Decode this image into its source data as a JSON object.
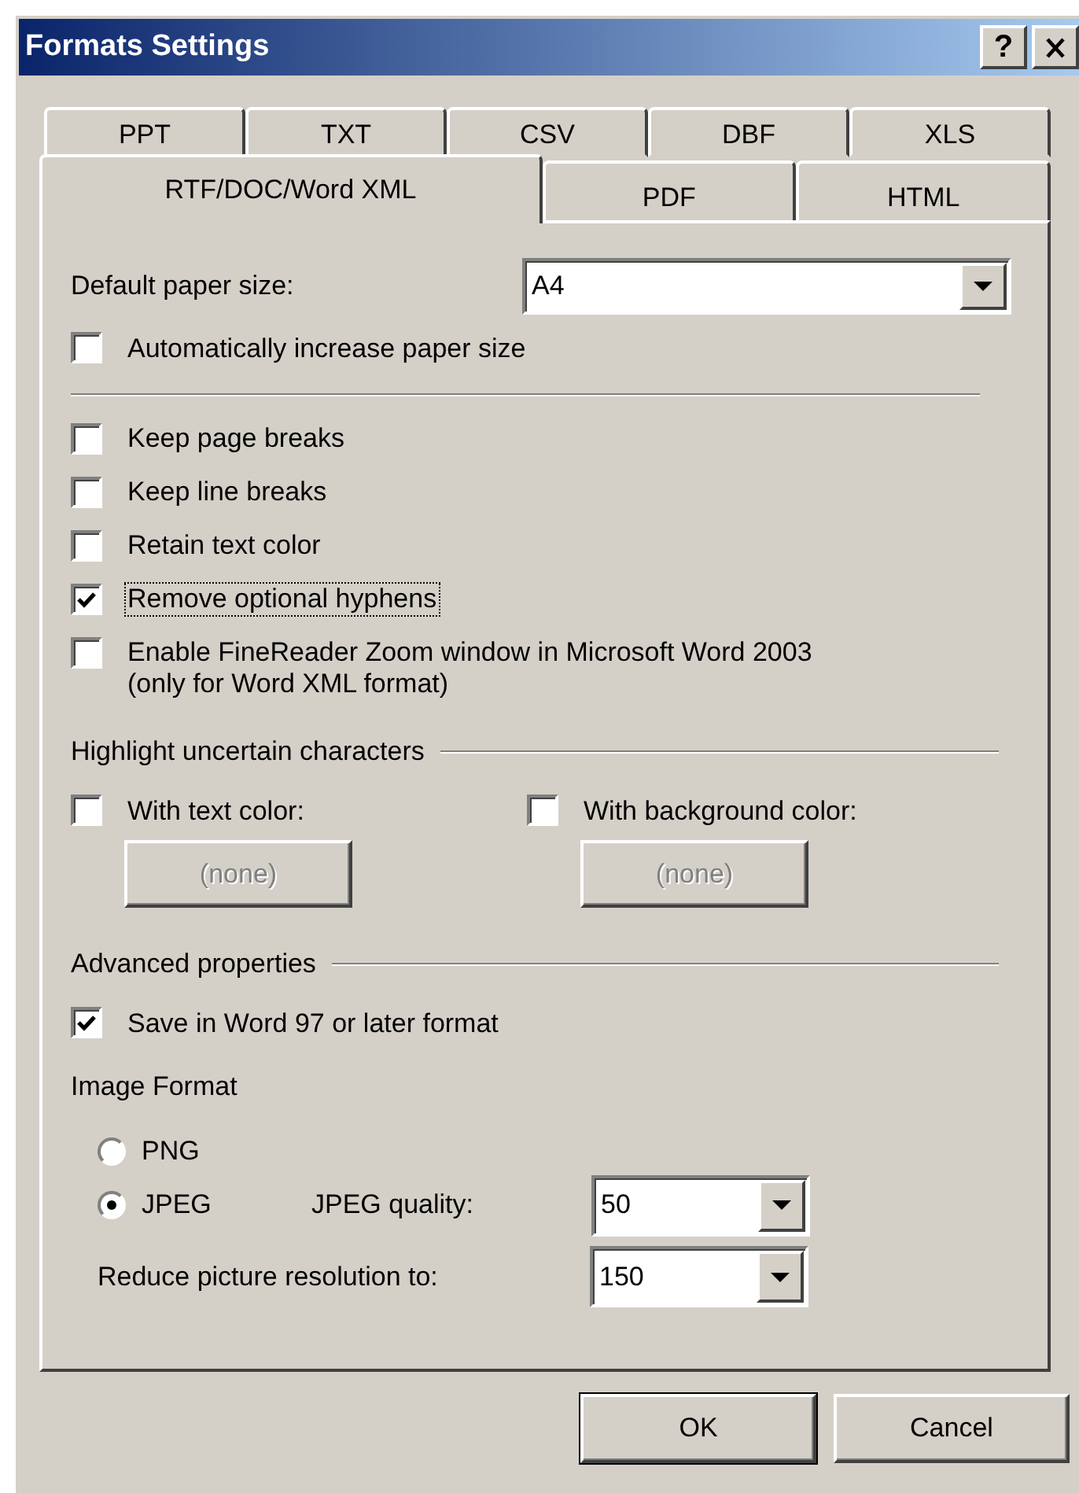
{
  "window": {
    "title": "Formats Settings",
    "help_button": "?"
  },
  "tab_rows": [
    [
      {
        "label": "PPT",
        "selected": false
      },
      {
        "label": "TXT",
        "selected": false
      },
      {
        "label": "CSV",
        "selected": false
      },
      {
        "label": "DBF",
        "selected": false
      },
      {
        "label": "XLS",
        "selected": false
      }
    ],
    [
      {
        "label": "RTF/DOC/Word XML",
        "selected": true
      },
      {
        "label": "PDF",
        "selected": false
      },
      {
        "label": "HTML",
        "selected": false
      }
    ]
  ],
  "paper_size": {
    "label": "Default paper size:",
    "value": "A4"
  },
  "paper_options": [
    {
      "label": "Automatically increase paper size",
      "checked": false,
      "focused": false
    }
  ],
  "options": [
    {
      "label": "Keep page breaks",
      "checked": false,
      "focused": false
    },
    {
      "label": "Keep line breaks",
      "checked": false,
      "focused": false
    },
    {
      "label": "Retain text color",
      "checked": false,
      "focused": false
    },
    {
      "label": "Remove optional hyphens",
      "checked": true,
      "focused": true
    },
    {
      "label": "Enable FineReader Zoom window in Microsoft Word 2003 (only for Word XML format)",
      "checked": false,
      "focused": false
    }
  ],
  "highlight": {
    "title": "Highlight uncertain characters",
    "items": [
      {
        "label": "With text color:",
        "checked": false,
        "button": "(none)",
        "disabled": true
      },
      {
        "label": "With background color:",
        "checked": false,
        "button": "(none)",
        "disabled": true
      }
    ]
  },
  "advanced": {
    "title": "Advanced properties",
    "save_word97": {
      "label": "Save in Word 97 or later format",
      "checked": true
    },
    "image_format_label": "Image Format",
    "formats": [
      {
        "label": "PNG",
        "selected": false
      },
      {
        "label": "JPEG",
        "selected": true
      }
    ],
    "jpeg_quality": {
      "label": "JPEG quality:",
      "value": "50"
    },
    "resolution": {
      "label": "Reduce picture resolution to:",
      "value": "150"
    }
  },
  "buttons": [
    {
      "label": "OK",
      "default": true
    },
    {
      "label": "Cancel",
      "default": false
    }
  ]
}
